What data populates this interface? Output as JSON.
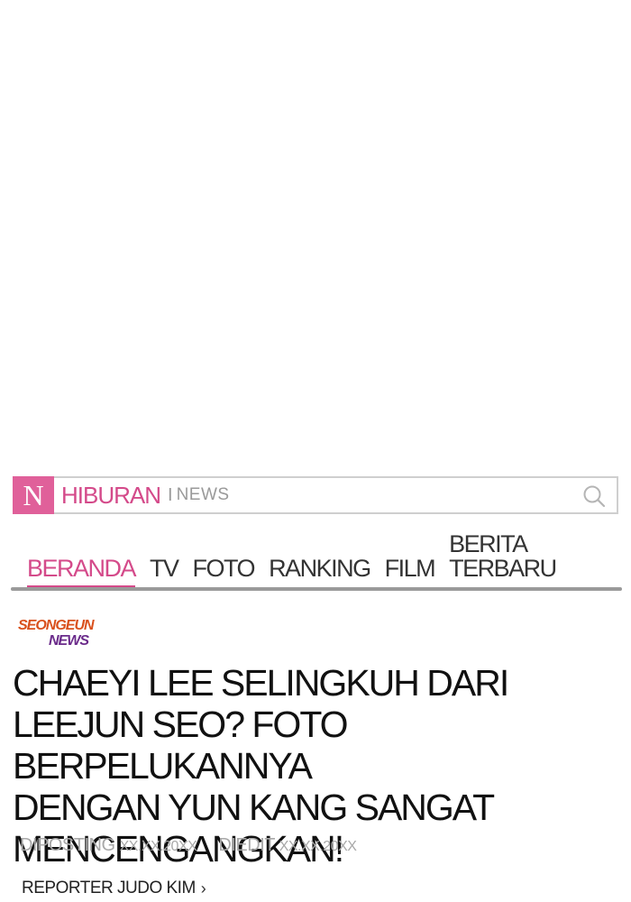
{
  "header": {
    "logo_letter": "N",
    "brand": "HIBURAN",
    "separator": "I",
    "brand_sub": "NEWS",
    "accent_color": "#e0609a",
    "search_icon": "search-icon"
  },
  "nav": {
    "items": [
      {
        "label": "BERANDA",
        "active": true
      },
      {
        "label": "TV",
        "active": false
      },
      {
        "label": "FOTO",
        "active": false
      },
      {
        "label": "RANKING",
        "active": false
      },
      {
        "label": "FILM",
        "active": false
      },
      {
        "label": "BERITA TERBARU",
        "active": false
      }
    ]
  },
  "article": {
    "source_logo_line1": "SEONGEUN",
    "source_logo_line2": "NEWS",
    "headline_lines": [
      "CHAEYI LEE SELINGKUH DARI",
      "LEEJUN SEO?  FOTO BERPELUKANNYA",
      "DENGAN YUN KANG SANGAT",
      "MENCENGANGKAN!"
    ],
    "posted_label": "DIPOSTING",
    "posted_date": "XX.XX.20XX",
    "edited_label": "DIEDIT",
    "edited_date": "XX.XX.20XX",
    "reporter": "REPORTER JUDO KIM",
    "reporter_chevron": "›"
  }
}
